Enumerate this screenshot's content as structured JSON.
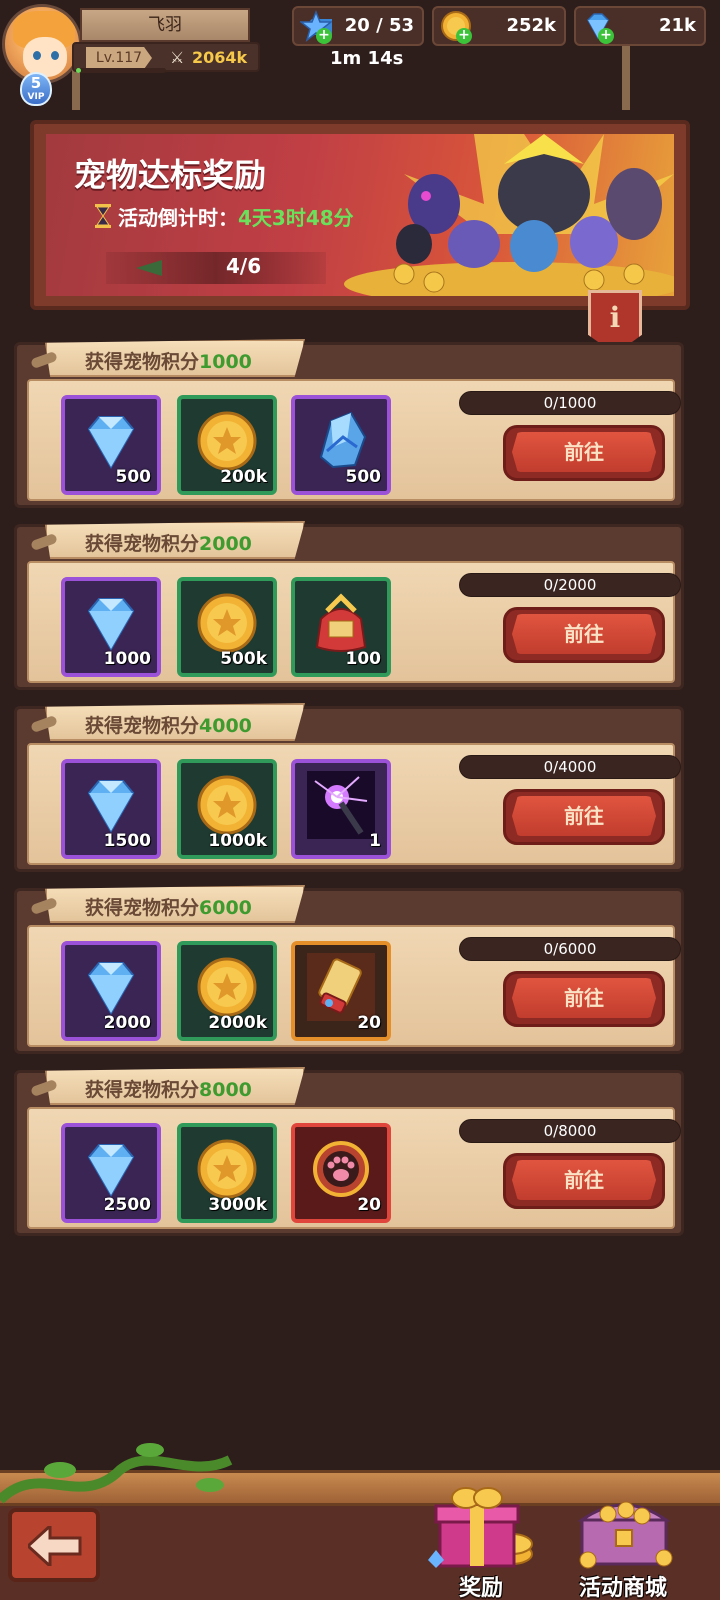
{
  "player": {
    "name": "飞羽",
    "level": "Lv.117",
    "power": "2064k",
    "vip_level": "5",
    "vip_label": "VIP",
    "exp_progress": 0.05
  },
  "resources": {
    "energy": "20 / 53",
    "energy_timer": "1m 14s",
    "gold": "252k",
    "gems": "21k"
  },
  "banner": {
    "title": "宠物达标奖励",
    "timer_label": "活动倒计时：",
    "timer_value": "4天3时48分",
    "progress": "4/6",
    "info_icon": "i"
  },
  "rewards": [
    {
      "label": "获得宠物积分",
      "points": "1000",
      "progress_text": "0/1000",
      "progress": 0,
      "button": "前往",
      "items": [
        {
          "icon": "diamond-icon",
          "qty": "500",
          "rarity": "purple"
        },
        {
          "icon": "gold-coin-icon",
          "qty": "200k",
          "rarity": "green"
        },
        {
          "icon": "crystal-shard-icon",
          "qty": "500",
          "rarity": "purple"
        }
      ]
    },
    {
      "label": "获得宠物积分",
      "points": "2000",
      "progress_text": "0/2000",
      "progress": 0,
      "button": "前往",
      "items": [
        {
          "icon": "diamond-icon",
          "qty": "1000",
          "rarity": "purple"
        },
        {
          "icon": "gold-coin-icon",
          "qty": "500k",
          "rarity": "green"
        },
        {
          "icon": "lucky-bag-icon",
          "qty": "100",
          "rarity": "green"
        }
      ]
    },
    {
      "label": "获得宠物积分",
      "points": "4000",
      "progress_text": "0/4000",
      "progress": 0,
      "button": "前往",
      "items": [
        {
          "icon": "diamond-icon",
          "qty": "1500",
          "rarity": "purple"
        },
        {
          "icon": "gold-coin-icon",
          "qty": "1000k",
          "rarity": "green"
        },
        {
          "icon": "lightning-staff-icon",
          "qty": "1",
          "rarity": "purple"
        }
      ]
    },
    {
      "label": "获得宠物积分",
      "points": "6000",
      "progress_text": "0/6000",
      "progress": 0,
      "button": "前往",
      "items": [
        {
          "icon": "diamond-icon",
          "qty": "2000",
          "rarity": "purple"
        },
        {
          "icon": "gold-coin-icon",
          "qty": "2000k",
          "rarity": "green"
        },
        {
          "icon": "summon-scroll-icon",
          "qty": "20",
          "rarity": "orange"
        }
      ]
    },
    {
      "label": "获得宠物积分",
      "points": "8000",
      "progress_text": "0/8000",
      "progress": 0,
      "button": "前往",
      "items": [
        {
          "icon": "diamond-icon",
          "qty": "2500",
          "rarity": "purple"
        },
        {
          "icon": "gold-coin-icon",
          "qty": "3000k",
          "rarity": "green"
        },
        {
          "icon": "paw-token-icon",
          "qty": "20",
          "rarity": "red"
        }
      ]
    }
  ],
  "bottom_nav": {
    "back_icon": "back-arrow-icon",
    "rewards_label": "奖励",
    "shop_label": "活动商城"
  },
  "colors": {
    "background": "#2e1e1b",
    "accent_green": "#3f9b2f",
    "button_red": "#c23d2e",
    "rarity_purple": "#9c52d8",
    "rarity_green": "#2f9a5a",
    "rarity_orange": "#e58f2b",
    "rarity_red": "#e0463c"
  }
}
